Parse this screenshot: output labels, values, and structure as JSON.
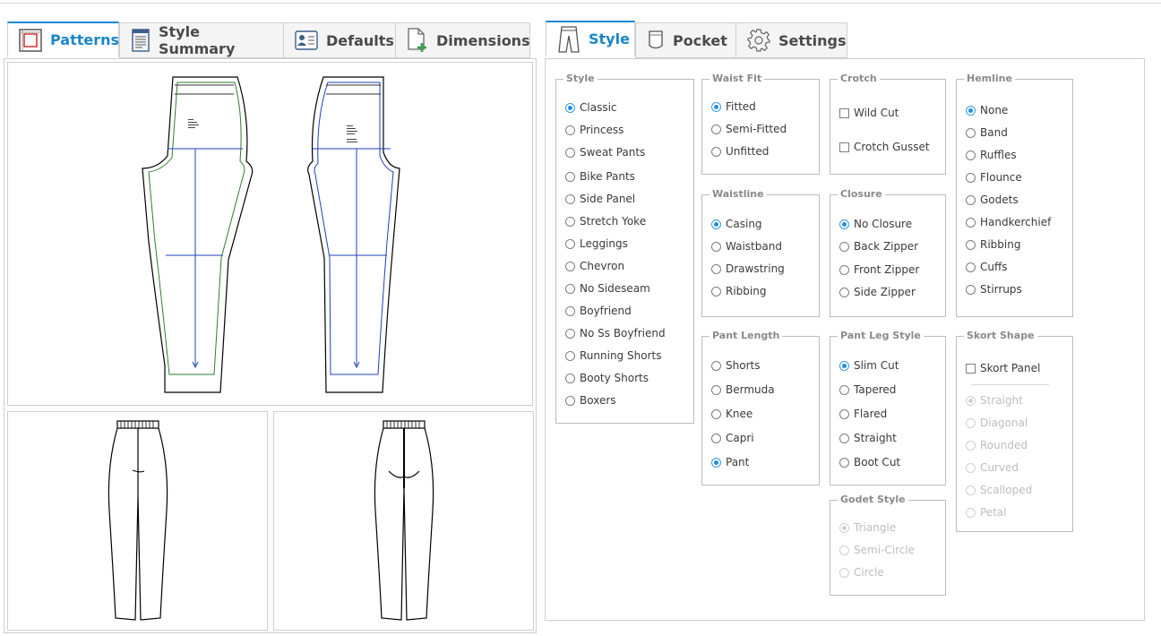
{
  "left_tabs": [
    {
      "label": "Patterns",
      "icon": "patterns-icon",
      "active": true
    },
    {
      "label": "Style Summary",
      "icon": "document-icon",
      "active": false
    },
    {
      "label": "Defaults",
      "icon": "profile-card-icon",
      "active": false
    },
    {
      "label": "Dimensions",
      "icon": "add-page-icon",
      "active": false
    }
  ],
  "right_tabs": [
    {
      "label": "Style",
      "icon": "pants-icon",
      "active": true
    },
    {
      "label": "Pocket",
      "icon": "pocket-icon",
      "active": false
    },
    {
      "label": "Settings",
      "icon": "gear-icon",
      "active": false
    }
  ],
  "style_group": {
    "legend": "Style",
    "options": [
      "Classic",
      "Princess",
      "Sweat Pants",
      "Bike Pants",
      "Side Panel",
      "Stretch Yoke",
      "Leggings",
      "Chevron",
      "No Sideseam",
      "Boyfriend",
      "No Ss Boyfriend",
      "Running Shorts",
      "Booty Shorts",
      "Boxers"
    ],
    "selected": "Classic"
  },
  "waist_fit": {
    "legend": "Waist Fit",
    "options": [
      "Fitted",
      "Semi-Fitted",
      "Unfitted"
    ],
    "selected": "Fitted"
  },
  "waistline": {
    "legend": "Waistline",
    "options": [
      "Casing",
      "Waistband",
      "Drawstring",
      "Ribbing"
    ],
    "selected": "Casing"
  },
  "pant_length": {
    "legend": "Pant Length",
    "options": [
      "Shorts",
      "Bermuda",
      "Knee",
      "Capri",
      "Pant"
    ],
    "selected": "Pant"
  },
  "crotch": {
    "legend": "Crotch",
    "checkboxes": [
      "Wild Cut",
      "Crotch Gusset"
    ]
  },
  "closure": {
    "legend": "Closure",
    "options": [
      "No Closure",
      "Back Zipper",
      "Front Zipper",
      "Side Zipper"
    ],
    "selected": "No Closure"
  },
  "pant_leg_style": {
    "legend": "Pant Leg Style",
    "options": [
      "Slim Cut",
      "Tapered",
      "Flared",
      "Straight",
      "Boot Cut"
    ],
    "selected": "Slim Cut"
  },
  "godet_style": {
    "legend": "Godet Style",
    "options": [
      "Triangle",
      "Semi-Circle",
      "Circle"
    ],
    "selected": "Triangle",
    "disabled": true
  },
  "hemline": {
    "legend": "Hemline",
    "options": [
      "None",
      "Band",
      "Ruffles",
      "Flounce",
      "Godets",
      "Handkerchief",
      "Ribbing",
      "Cuffs",
      "Stirrups"
    ],
    "selected": "None"
  },
  "skort_shape": {
    "legend": "Skort Shape",
    "checkbox": "Skort Panel",
    "options": [
      "Straight",
      "Diagonal",
      "Rounded",
      "Curved",
      "Scalloped",
      "Petal"
    ],
    "selected": "Straight",
    "disabled": true
  },
  "colors": {
    "accent": "#1b86c9",
    "border": "#cfcfcf",
    "pattern_green": "#2e7d32",
    "pattern_blue": "#1f3fbf"
  }
}
